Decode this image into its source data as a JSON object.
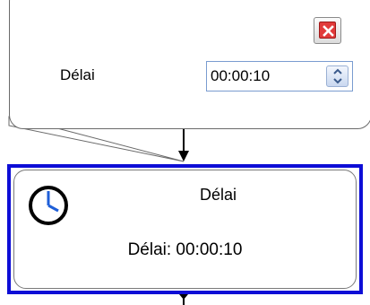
{
  "popup": {
    "delay_label": "Délai",
    "delay_value": "00:00:10",
    "close_icon": "close-icon",
    "spinner_icons": [
      "chevron-up-icon",
      "chevron-down-icon"
    ]
  },
  "node": {
    "title": "Délai",
    "summary": "Délai: 00:00:10",
    "icon": "clock-icon",
    "selection_color": "#0d0dd6",
    "clock_hand_color": "#1f5fd8"
  },
  "colors": {
    "close": "#e13a3a",
    "connector": "#000000"
  }
}
